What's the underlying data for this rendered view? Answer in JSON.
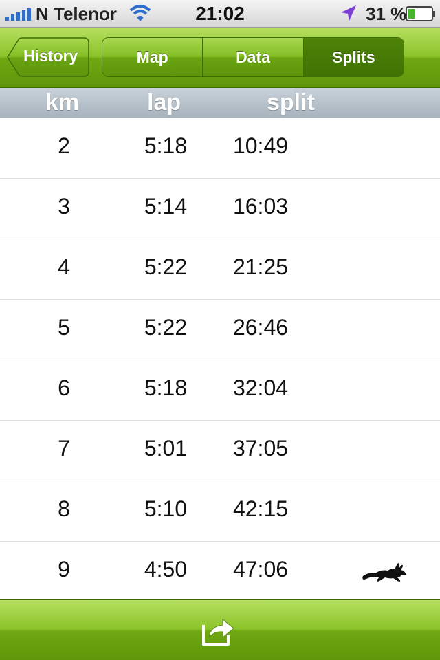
{
  "status_bar": {
    "carrier": "N Telenor",
    "time": "21:02",
    "battery_percent": "31 %",
    "battery_level": 0.31,
    "icons": [
      "signal-icon",
      "wifi-icon",
      "location-arrow-icon",
      "battery-icon"
    ]
  },
  "nav": {
    "back_label": "History",
    "segments": [
      {
        "label": "Map",
        "active": false
      },
      {
        "label": "Data",
        "active": false
      },
      {
        "label": "Splits",
        "active": true
      }
    ]
  },
  "table": {
    "headers": {
      "km": "km",
      "lap": "lap",
      "split": "split"
    },
    "rows": [
      {
        "km": "2",
        "lap": "5:18",
        "split": "10:49",
        "fastest": false
      },
      {
        "km": "3",
        "lap": "5:14",
        "split": "16:03",
        "fastest": false
      },
      {
        "km": "4",
        "lap": "5:22",
        "split": "21:25",
        "fastest": false
      },
      {
        "km": "5",
        "lap": "5:22",
        "split": "26:46",
        "fastest": false
      },
      {
        "km": "6",
        "lap": "5:18",
        "split": "32:04",
        "fastest": false
      },
      {
        "km": "7",
        "lap": "5:01",
        "split": "37:05",
        "fastest": false
      },
      {
        "km": "8",
        "lap": "5:10",
        "split": "42:15",
        "fastest": false
      },
      {
        "km": "9",
        "lap": "4:50",
        "split": "47:06",
        "fastest": true
      }
    ],
    "fastest_icon": "rabbit-icon"
  },
  "toolbar": {
    "icon": "share-icon"
  },
  "colors": {
    "nav_green": "#7cb61c",
    "active_segment": "#4a7d06",
    "header_gray": "#b4bec7"
  }
}
